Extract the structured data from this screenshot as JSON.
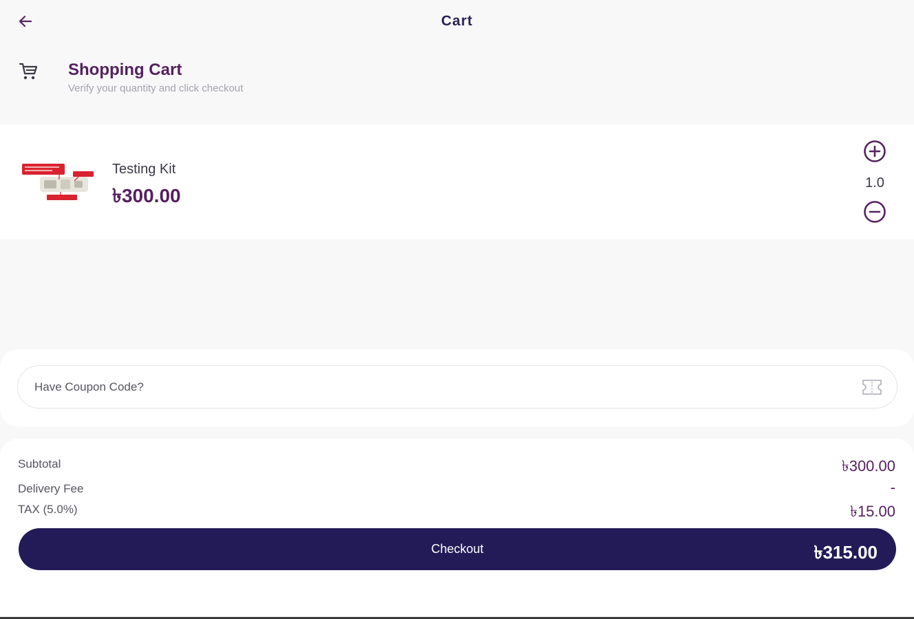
{
  "topbar": {
    "title": "Cart",
    "back_icon": "arrow-left-icon"
  },
  "header": {
    "icon": "shopping-cart-icon",
    "title": "Shopping Cart",
    "subtitle": "Verify your quantity and click checkout"
  },
  "items": [
    {
      "name": "Testing Kit",
      "price": "৳300.00",
      "quantity": "1.0"
    }
  ],
  "coupon": {
    "placeholder": "Have Coupon Code?",
    "icon": "ticket-icon"
  },
  "summary": {
    "subtotal_label": "Subtotal",
    "subtotal_value": "৳300.00",
    "delivery_label": "Delivery Fee",
    "delivery_value": "-",
    "tax_label": "TAX (5.0%)",
    "tax_value": "৳15.00"
  },
  "checkout": {
    "label": "Checkout",
    "total": "৳315.00"
  },
  "colors": {
    "accent": "#55215f",
    "button": "#231b57",
    "background": "#f8f8f9"
  }
}
